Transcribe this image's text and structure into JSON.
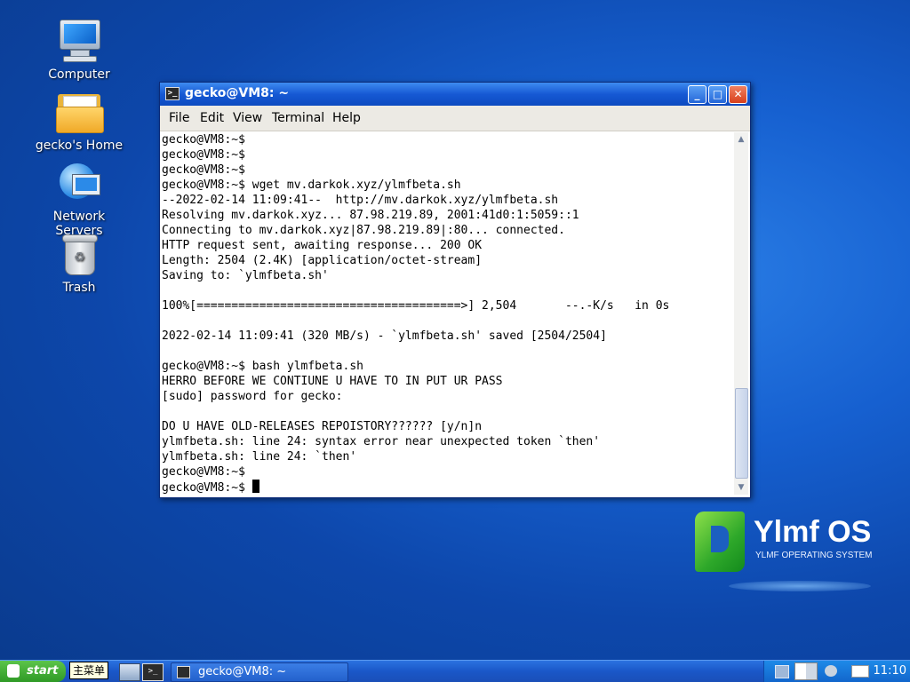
{
  "desktop": {
    "icons": [
      {
        "label": "Computer",
        "icon": "computer-icon"
      },
      {
        "label": "gecko's Home",
        "icon": "home-folder-icon"
      },
      {
        "label": "Network Servers",
        "icon": "network-servers-icon"
      },
      {
        "label": "Trash",
        "icon": "trash-icon"
      }
    ],
    "logo": {
      "name": "Ylmf OS",
      "subtitle": "YLMF OPERATING SYSTEM"
    }
  },
  "window": {
    "title": "gecko@VM8: ~",
    "controls": {
      "minimize": "_",
      "maximize": "□",
      "close": "✕"
    },
    "menu": [
      "File",
      "Edit",
      "View",
      "Terminal",
      "Help"
    ],
    "terminal_lines": [
      "gecko@VM8:~$",
      "gecko@VM8:~$",
      "gecko@VM8:~$",
      "gecko@VM8:~$ wget mv.darkok.xyz/ylmfbeta.sh",
      "--2022-02-14 11:09:41--  http://mv.darkok.xyz/ylmfbeta.sh",
      "Resolving mv.darkok.xyz... 87.98.219.89, 2001:41d0:1:5059::1",
      "Connecting to mv.darkok.xyz|87.98.219.89|:80... connected.",
      "HTTP request sent, awaiting response... 200 OK",
      "Length: 2504 (2.4K) [application/octet-stream]",
      "Saving to: `ylmfbeta.sh'",
      "",
      "100%[======================================>] 2,504       --.-K/s   in 0s",
      "",
      "2022-02-14 11:09:41 (320 MB/s) - `ylmfbeta.sh' saved [2504/2504]",
      "",
      "gecko@VM8:~$ bash ylmfbeta.sh",
      "HERRO BEFORE WE CONTIUNE U HAVE TO IN PUT UR PASS",
      "[sudo] password for gecko:",
      "",
      "DO U HAVE OLD-RELEASES REPOISTORY?????? [y/n]n",
      "ylmfbeta.sh: line 24: syntax error near unexpected token `then'",
      "ylmfbeta.sh: line 24: `then'",
      "gecko@VM8:~$"
    ],
    "prompt": "gecko@VM8:~$ "
  },
  "taskbar": {
    "start_label": "start",
    "tooltip": "主菜单",
    "task_title": "gecko@VM8: ~",
    "clock": "11:10",
    "colors": {
      "start": "#2f9a26",
      "bar": "#1a57c8"
    }
  }
}
